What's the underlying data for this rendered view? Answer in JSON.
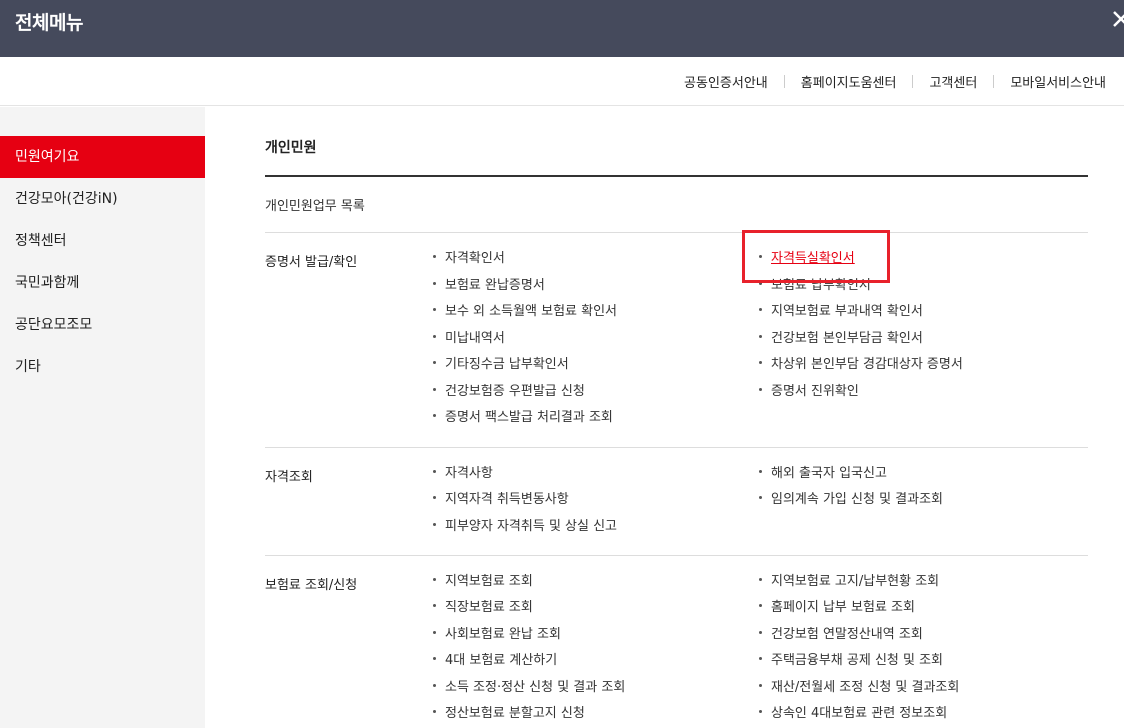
{
  "header": {
    "title": "전체메뉴",
    "close_icon": "close-icon"
  },
  "utility_links": [
    "공동인증서안내",
    "홈페이지도움센터",
    "고객센터",
    "모바일서비스안내"
  ],
  "sidebar": {
    "items": [
      {
        "label": "민원여기요",
        "active": true
      },
      {
        "label": "건강모아(건강iN)",
        "active": false
      },
      {
        "label": "정책센터",
        "active": false
      },
      {
        "label": "국민과함께",
        "active": false
      },
      {
        "label": "공단요모조모",
        "active": false
      },
      {
        "label": "기타",
        "active": false
      }
    ]
  },
  "main": {
    "section_title": "개인민원",
    "subtitle": "개인민원업무 목록",
    "categories": [
      {
        "label": "증명서 발급/확인",
        "left": [
          "자격확인서",
          "보험료 완납증명서",
          "보수 외 소득월액 보험료 확인서",
          "미납내역서",
          "기타징수금 납부확인서",
          "건강보험증 우편발급 신청",
          "증명서 팩스발급 처리결과 조회"
        ],
        "right": [
          "자격득실확인서",
          "보험료 납부확인서",
          "지역보험료 부과내역 확인서",
          "건강보험 본인부담금 확인서",
          "차상위 본인부담 경감대상자 증명서",
          "증명서 진위확인"
        ]
      },
      {
        "label": "자격조회",
        "left": [
          "자격사항",
          "지역자격 취득변동사항",
          "피부양자 자격취득 및 상실 신고"
        ],
        "right": [
          "해외 출국자 입국신고",
          "임의계속 가입 신청 및 결과조회"
        ]
      },
      {
        "label": "보험료 조회/신청",
        "left": [
          "지역보험료 조회",
          "직장보험료 조회",
          "사회보험료 완납 조회",
          "4대 보험료 계산하기",
          "소득 조정·정산 신청 및 결과 조회",
          "정산보험료 분할고지 신청"
        ],
        "right": [
          "지역보험료 고지/납부현황 조회",
          "홈페이지 납부 보험료 조회",
          "건강보험 연말정산내역 조회",
          "주택금융부채 공제 신청 및 조회",
          "재산/전월세 조정 신청 및 결과조회",
          "상속인 4대보험료 관련 정보조회"
        ]
      }
    ],
    "selected_item": "자격득실확인서"
  },
  "colors": {
    "topbar": "#454a5c",
    "accent_red": "#e60012",
    "highlight_box": "#e8212b"
  }
}
